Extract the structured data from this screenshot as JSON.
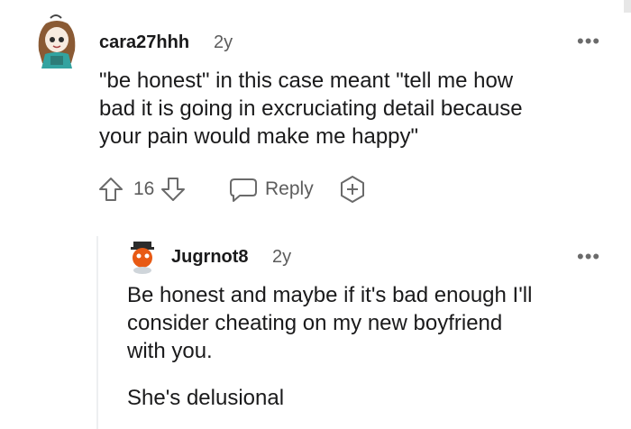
{
  "comment": {
    "username": "cara27hhh",
    "age": "2y",
    "more_icon": "•••",
    "body_lines": [
      "\"be honest\" in this case meant \"tell me how",
      "bad it is going in excruciating detail because",
      "your pain would make me happy\""
    ],
    "vote_count": "16",
    "reply_label": "Reply"
  },
  "reply": {
    "username": "Jugrnot8",
    "age": "2y",
    "more_icon": "•••",
    "body_lines": [
      "Be honest and maybe if it's bad enough I'll",
      "consider cheating on my new boyfriend",
      "with you.",
      "She's delusional"
    ]
  },
  "colors": {
    "text": "#1a1a1b",
    "meta": "#5c5c5c",
    "thread": "#edeff1"
  }
}
